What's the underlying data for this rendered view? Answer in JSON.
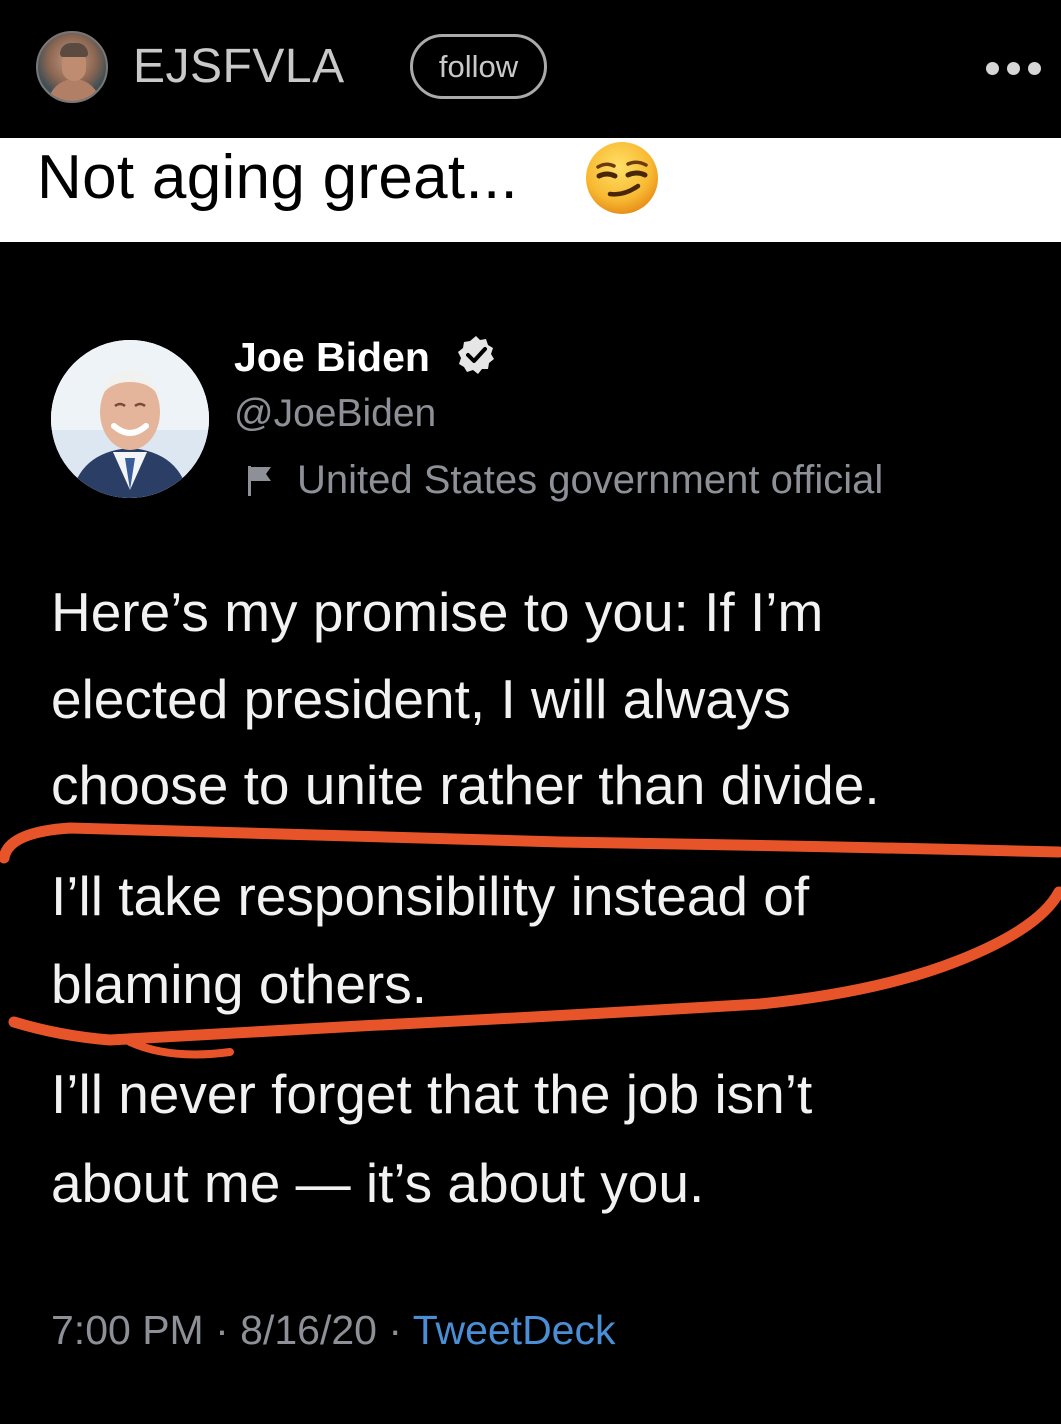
{
  "header": {
    "username": "EJSFVLA",
    "follow_label": "follow",
    "more_icon": "more-dots-icon"
  },
  "caption": {
    "text": "Not aging great...",
    "emoji": "smirking-face-icon"
  },
  "tweet": {
    "display_name": "Joe Biden",
    "verified_icon": "verified-badge-icon",
    "handle": "@JoeBiden",
    "affiliation_icon": "flag-icon",
    "affiliation": "United States government official",
    "body_lines": [
      "Here’s my promise to you: If I’m",
      "elected president, I will always",
      "choose to unite rather than divide.",
      "I’ll take responsibility instead of",
      "blaming others.",
      "I’ll never forget that the job isn’t",
      "about me — it’s about you."
    ],
    "time": "7:00 PM",
    "date": "8/16/20",
    "source": "TweetDeck",
    "separator": "·"
  },
  "colors": {
    "background": "#000000",
    "caption_background": "#ffffff",
    "annotation": "#e8542a",
    "link": "#4a8fd6",
    "muted_text": "#8d9096"
  }
}
